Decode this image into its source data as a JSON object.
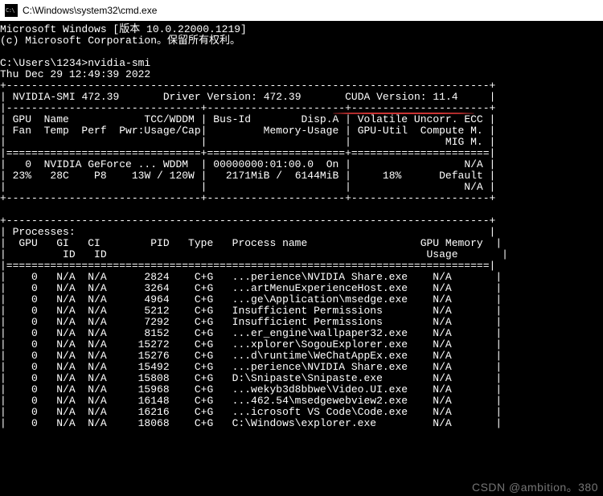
{
  "title": "C:\\Windows\\system32\\cmd.exe",
  "banner": {
    "line1": "Microsoft Windows [版本 10.0.22000.1219]",
    "line2": "(c) Microsoft Corporation。保留所有权利。"
  },
  "prompt": {
    "path": "C:\\Users\\1234>",
    "cmd": "nvidia-smi"
  },
  "timestamp": "Thu Dec 29 12:49:39 2022",
  "smi": {
    "header": {
      "nvsmi_label": "NVIDIA-SMI",
      "nvsmi_ver": "472.39",
      "driver_label": "Driver Version:",
      "driver_ver": "472.39",
      "cuda_label": "CUDA Version:",
      "cuda_ver": "11.4"
    },
    "cols": {
      "g1a": "GPU  Name            TCC/WDDM",
      "g1b": "Fan  Temp  Perf  Pwr:Usage/Cap",
      "g2a": "Bus-Id        Disp.A",
      "g2b": "Memory-Usage",
      "g3a": "Volatile Uncorr. ECC",
      "g3b": "GPU-Util  Compute M.",
      "g3c": "MIG M."
    },
    "gpu": {
      "r1c1": "  0  NVIDIA GeForce ... WDDM ",
      "r1c2": "00000000:01:00.0  On",
      "r1c3": "N/A",
      "r2c1": " 23%   28C    P8    13W / 120W",
      "r2c2": "2171MiB /  6144MiB",
      "r2c3": "18%      Default",
      "r3c3": "N/A"
    },
    "proc": {
      "title": "Processes:",
      "h1": " GPU   GI   CI        PID   Type   Process name                  GPU Memory ",
      "h2": "        ID   ID                                                   Usage      ",
      "rows": [
        "   0   N/A  N/A      2824    C+G   ...perience\\NVIDIA Share.exe    N/A      ",
        "   0   N/A  N/A      3264    C+G   ...artMenuExperienceHost.exe    N/A      ",
        "   0   N/A  N/A      4964    C+G   ...ge\\Application\\msedge.exe    N/A      ",
        "   0   N/A  N/A      5212    C+G   Insufficient Permissions        N/A      ",
        "   0   N/A  N/A      7292    C+G   Insufficient Permissions        N/A      ",
        "   0   N/A  N/A      8152    C+G   ...er_engine\\wallpaper32.exe    N/A      ",
        "   0   N/A  N/A     15272    C+G   ...xplorer\\SogouExplorer.exe    N/A      ",
        "   0   N/A  N/A     15276    C+G   ...d\\runtime\\WeChatAppEx.exe    N/A      ",
        "   0   N/A  N/A     15492    C+G   ...perience\\NVIDIA Share.exe    N/A      ",
        "   0   N/A  N/A     15808    C+G   D:\\Snipaste\\Snipaste.exe        N/A      ",
        "   0   N/A  N/A     15968    C+G   ...wekyb3d8bbwe\\Video.UI.exe    N/A      ",
        "   0   N/A  N/A     16148    C+G   ...462.54\\msedgewebview2.exe    N/A      ",
        "   0   N/A  N/A     16216    C+G   ...icrosoft VS Code\\Code.exe    N/A      ",
        "   0   N/A  N/A     18068    C+G   C:\\Windows\\explorer.exe         N/A      "
      ]
    }
  },
  "watermark": "CSDN @ambition。380"
}
